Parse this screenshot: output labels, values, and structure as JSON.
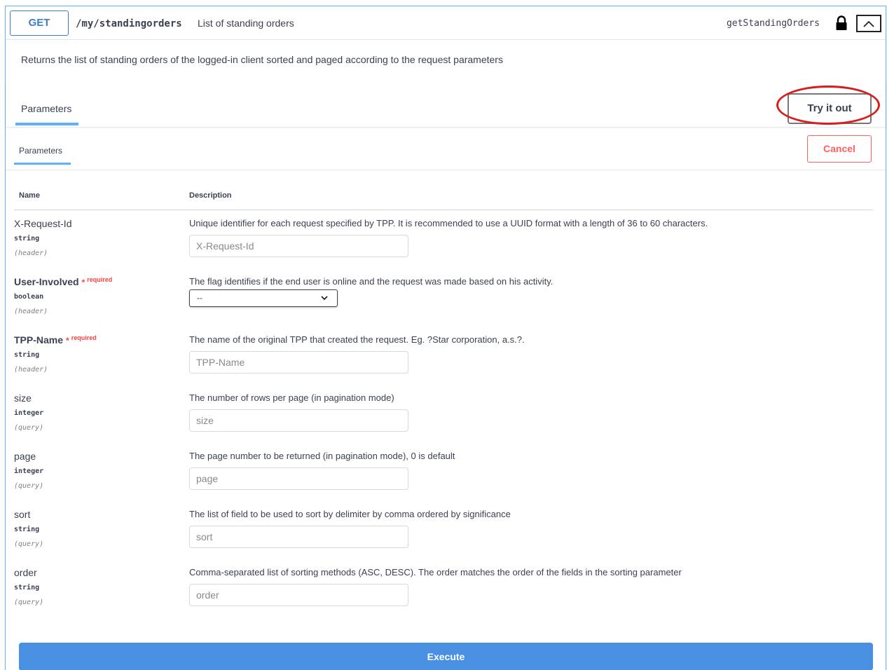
{
  "summary": {
    "method": "GET",
    "path": "/my/standingorders",
    "path_description": "List of standing orders",
    "operation_id": "getStandingOrders"
  },
  "description": "Returns the list of standing orders of the logged-in client sorted and paged according to the request parameters",
  "section_top": {
    "tab_label": "Parameters",
    "try_label": "Try it out"
  },
  "section_edit": {
    "tab_label": "Parameters",
    "cancel_label": "Cancel"
  },
  "columns": {
    "name": "Name",
    "description": "Description"
  },
  "required_text": "required",
  "params": [
    {
      "name": "X-Request-Id",
      "type": "string",
      "in": "(header)",
      "required": false,
      "description": "Unique identifier for each request specified by TPP. It is recommended to use a UUID format with a length of 36 to 60 characters.",
      "placeholder": "X-Request-Id"
    },
    {
      "name": "User-Involved",
      "type": "boolean",
      "in": "(header)",
      "required": true,
      "description": "The flag identifies if the end user is online and the request was made based on his activity.",
      "select_value": "--"
    },
    {
      "name": "TPP-Name",
      "type": "string",
      "in": "(header)",
      "required": true,
      "description": "The name of the original TPP that created the request. Eg. ?Star corporation, a.s.?.",
      "placeholder": "TPP-Name"
    },
    {
      "name": "size",
      "type": "integer",
      "in": "(query)",
      "required": false,
      "description": "The number of rows per page (in pagination mode)",
      "placeholder": "size"
    },
    {
      "name": "page",
      "type": "integer",
      "in": "(query)",
      "required": false,
      "description": "The page number to be returned (in pagination mode), 0 is default",
      "placeholder": "page"
    },
    {
      "name": "sort",
      "type": "string",
      "in": "(query)",
      "required": false,
      "description": "The list of field to be used to sort by delimiter by comma ordered by significance",
      "placeholder": "sort"
    },
    {
      "name": "order",
      "type": "string",
      "in": "(query)",
      "required": false,
      "description": "Comma-separated list of sorting methods (ASC, DESC). The order matches the order of the fields in the sorting parameter",
      "placeholder": "order"
    }
  ],
  "execute_label": "Execute",
  "colors": {
    "accent": "#61affe",
    "execute": "#4990e2",
    "cancel": "#ff6060",
    "highlight": "#d61e1e"
  },
  "icons": {
    "lock": "lock-icon",
    "collapse": "chevron-up-icon",
    "select": "chevron-down-icon"
  }
}
